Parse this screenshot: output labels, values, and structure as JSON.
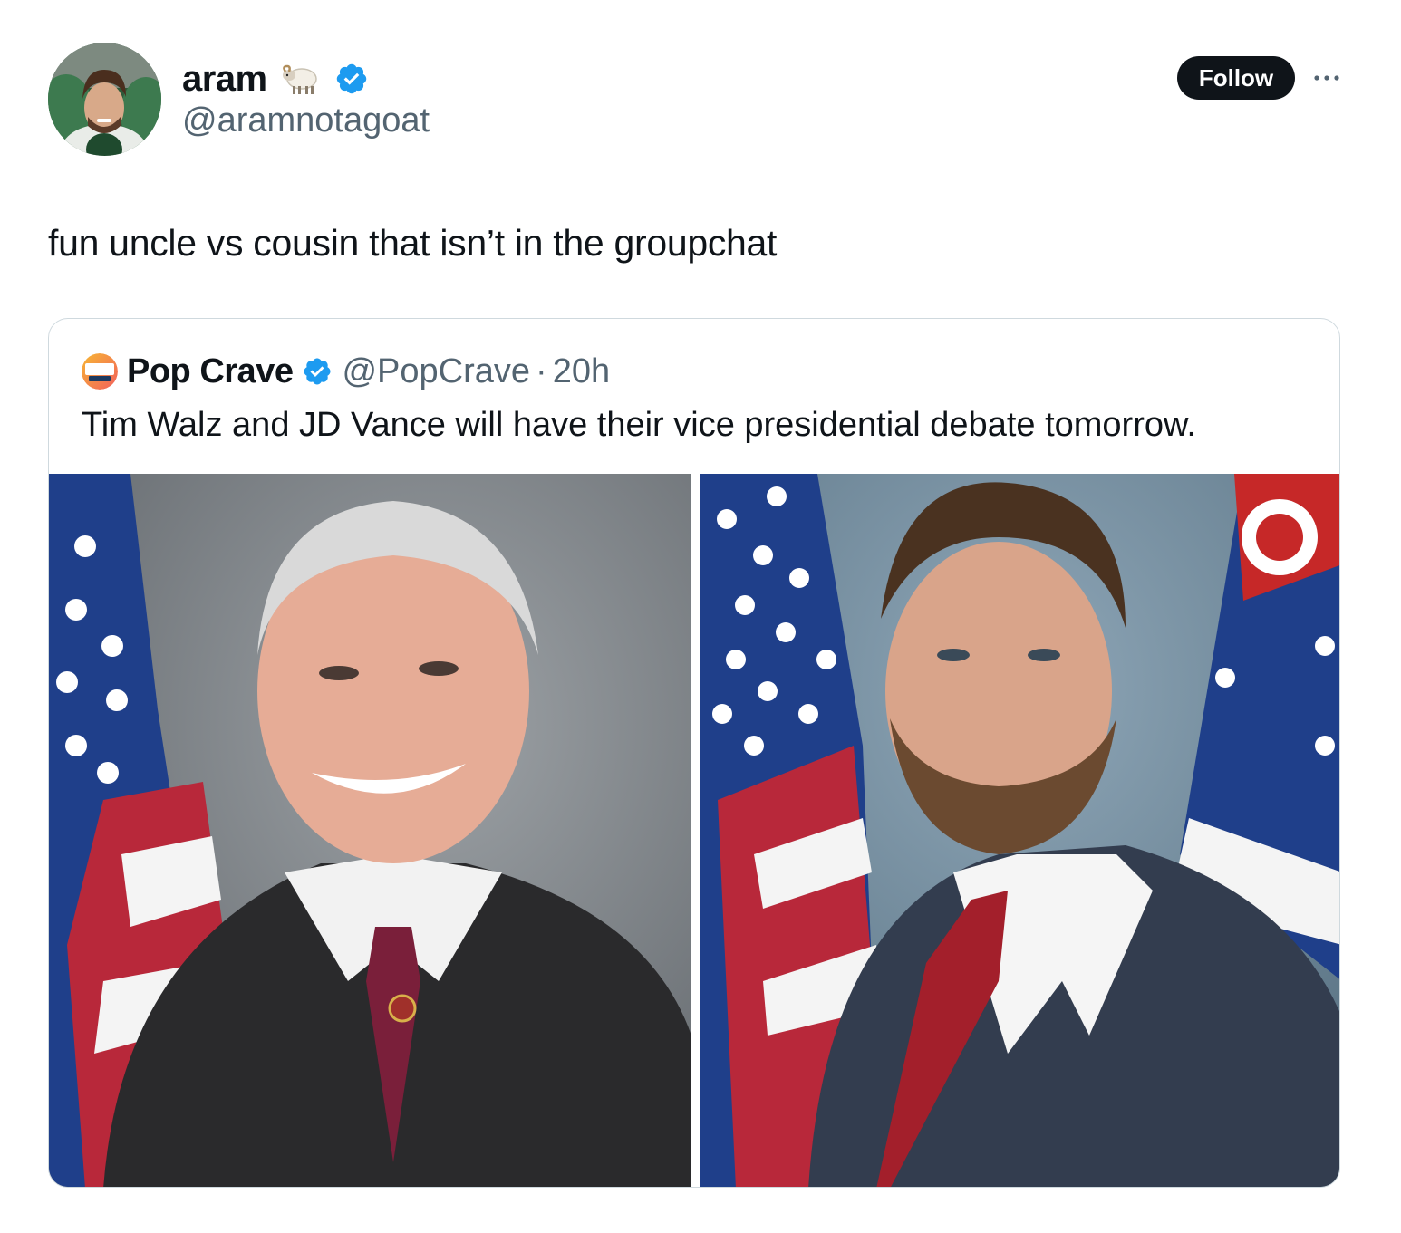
{
  "author": {
    "display_name": "aram",
    "name_emoji": "ram-emoji",
    "handle": "@aramnotagoat",
    "verified": true,
    "avatar_icon": "avatar"
  },
  "actions": {
    "follow_label": "Follow",
    "more_icon": "more-icon"
  },
  "tweet": {
    "text": "fun uncle vs cousin that isn’t in the groupchat"
  },
  "quoted_tweet": {
    "display_name": "Pop Crave",
    "handle": "@PopCrave",
    "separator": "·",
    "time": "20h",
    "verified": true,
    "text": "Tim Walz and JD Vance will have their vice presidential debate tomorrow.",
    "media": [
      "portrait-photo-left",
      "portrait-photo-right"
    ]
  },
  "colors": {
    "text_primary": "#0f1419",
    "text_secondary": "#536471",
    "verified_blue": "#1d9bf0",
    "border": "#cfd9de",
    "follow_bg": "#0f1419"
  }
}
